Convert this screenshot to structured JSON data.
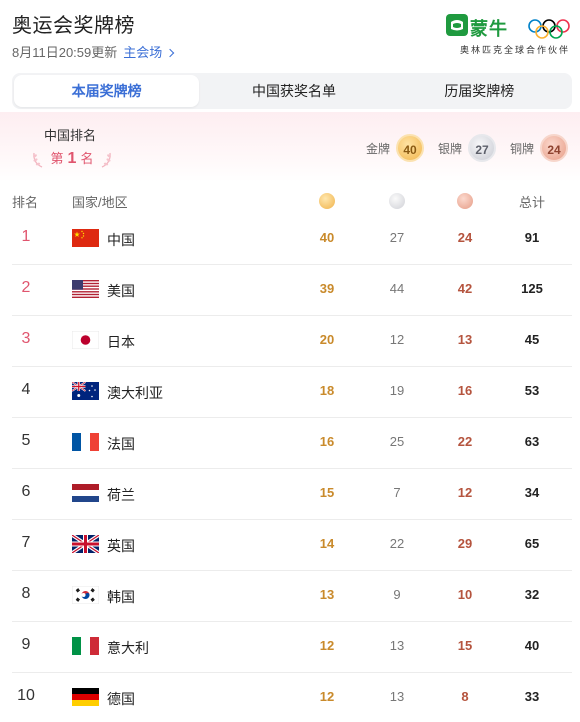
{
  "header": {
    "title": "奥运会奖牌榜",
    "update_time": "8月11日20:59更新",
    "venue_link": "主会场",
    "sponsor_name": "蒙牛",
    "sponsor_slogan": "奥林匹克全球合作伙伴"
  },
  "tabs": [
    {
      "label": "本届奖牌榜",
      "active": true
    },
    {
      "label": "中国获奖名单",
      "active": false
    },
    {
      "label": "历届奖牌榜",
      "active": false
    }
  ],
  "china_summary": {
    "label": "中国排名",
    "rank_prefix": "第",
    "rank": "1",
    "rank_suffix": "名",
    "gold_label": "金牌",
    "gold": "40",
    "silver_label": "银牌",
    "silver": "27",
    "bronze_label": "铜牌",
    "bronze": "24"
  },
  "table": {
    "col_rank": "排名",
    "col_country": "国家/地区",
    "col_total": "总计",
    "rows": [
      {
        "rank": "1",
        "country": "中国",
        "flag": "flag-china",
        "gold": "40",
        "silver": "27",
        "bronze": "24",
        "total": "91"
      },
      {
        "rank": "2",
        "country": "美国",
        "flag": "flag-usa",
        "gold": "39",
        "silver": "44",
        "bronze": "42",
        "total": "125"
      },
      {
        "rank": "3",
        "country": "日本",
        "flag": "flag-japan",
        "gold": "20",
        "silver": "12",
        "bronze": "13",
        "total": "45"
      },
      {
        "rank": "4",
        "country": "澳大利亚",
        "flag": "flag-australia",
        "gold": "18",
        "silver": "19",
        "bronze": "16",
        "total": "53"
      },
      {
        "rank": "5",
        "country": "法国",
        "flag": "flag-france",
        "gold": "16",
        "silver": "25",
        "bronze": "22",
        "total": "63"
      },
      {
        "rank": "6",
        "country": "荷兰",
        "flag": "flag-netherlands",
        "gold": "15",
        "silver": "7",
        "bronze": "12",
        "total": "34"
      },
      {
        "rank": "7",
        "country": "英国",
        "flag": "flag-uk",
        "gold": "14",
        "silver": "22",
        "bronze": "29",
        "total": "65"
      },
      {
        "rank": "8",
        "country": "韩国",
        "flag": "flag-korea",
        "gold": "13",
        "silver": "9",
        "bronze": "10",
        "total": "32"
      },
      {
        "rank": "9",
        "country": "意大利",
        "flag": "flag-italy",
        "gold": "12",
        "silver": "13",
        "bronze": "15",
        "total": "40"
      },
      {
        "rank": "10",
        "country": "德国",
        "flag": "flag-germany",
        "gold": "12",
        "silver": "13",
        "bronze": "8",
        "total": "33"
      }
    ]
  },
  "colors": {
    "accent": "#3b6fd6",
    "rank_highlight": "#e0556e",
    "gold_text": "#c98a2b",
    "bronze_text": "#b5543e"
  }
}
